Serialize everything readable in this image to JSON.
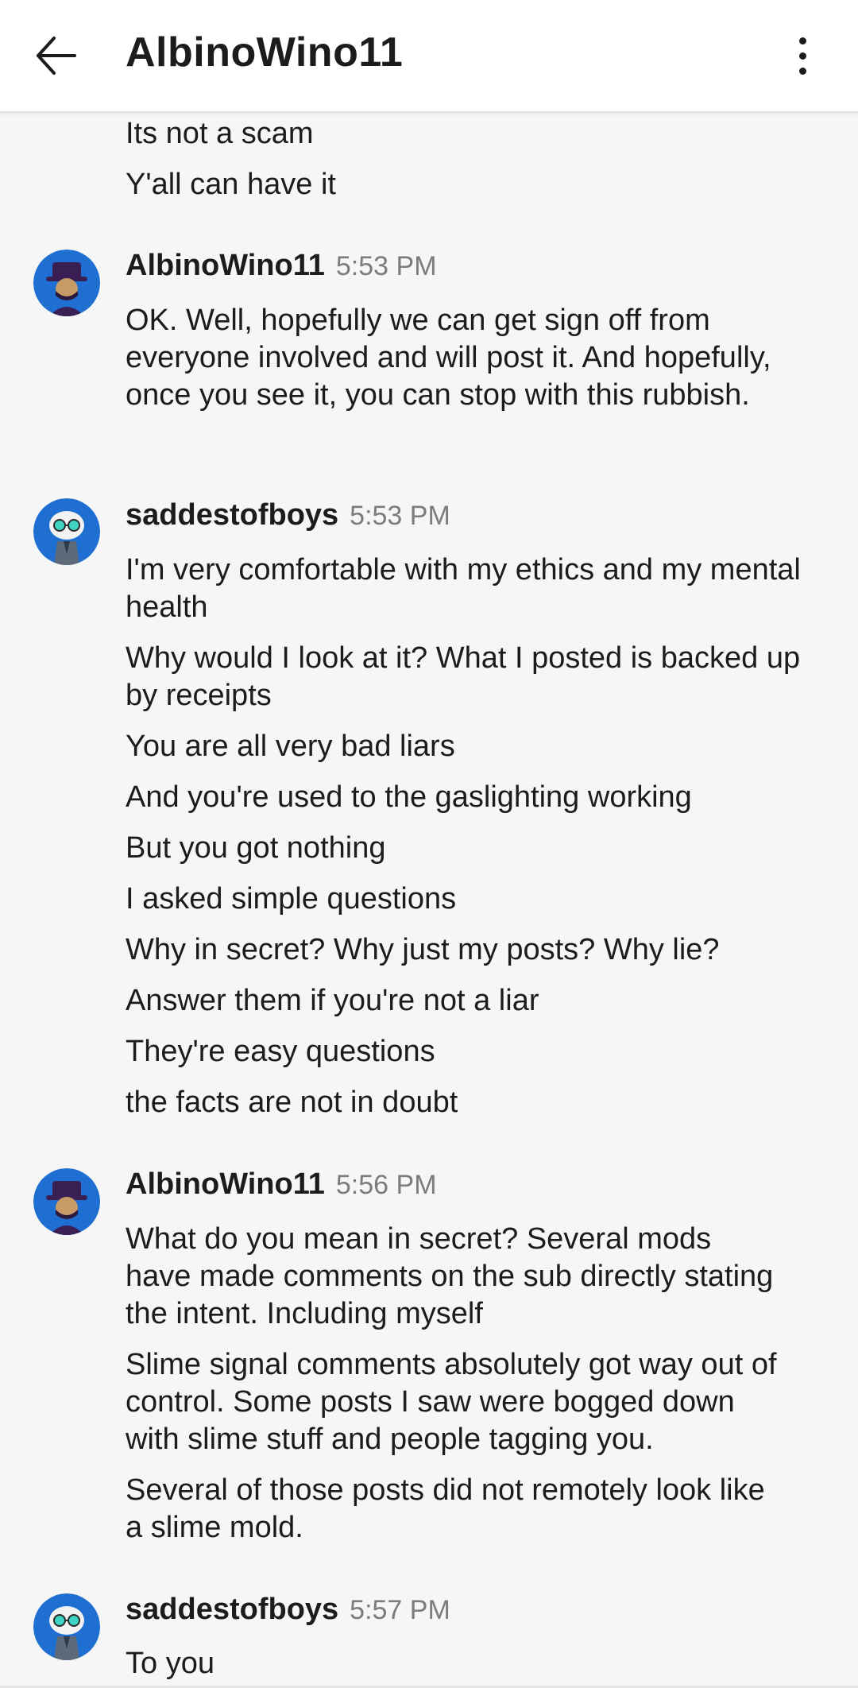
{
  "header": {
    "title": "AlbinoWino11",
    "back_icon": "arrow-left-icon",
    "menu_icon": "more-vertical-icon"
  },
  "colors": {
    "background": "#f6f6f6",
    "header_bg": "#ffffff",
    "timestamp": "#7c7c7c",
    "avatar_bg": "#1e6fd1"
  },
  "chat": {
    "preamble": [
      "Its not a scam",
      "Y'all can have it"
    ],
    "groups": [
      {
        "user": "AlbinoWino11",
        "time": "5:53 PM",
        "messages": [
          "OK.  Well, hopefully we can get sign off from everyone involved and will post it.  And hopefully, once you see it, you can stop with this rubbish."
        ]
      },
      {
        "user": "saddestofboys",
        "time": "5:53 PM",
        "messages": [
          "I'm very comfortable with my ethics and my mental health",
          "Why would I look at it? What I posted is backed up by receipts",
          "You are all very bad liars",
          "And you're used to the gaslighting working",
          "But you got nothing",
          "I asked simple questions",
          "Why in secret? Why just my posts? Why lie?",
          "Answer them if you're not a liar",
          "They're easy questions",
          "the facts are not in doubt"
        ]
      },
      {
        "user": "AlbinoWino11",
        "time": "5:56 PM",
        "messages": [
          "What do you mean in secret?  Several mods have made comments on the sub directly stating the intent.  Including myself",
          "Slime signal comments absolutely got way out of control.  Some posts I saw were bogged down with slime stuff and people tagging you.",
          "Several of those posts did not remotely look like a slime mold."
        ]
      },
      {
        "user": "saddestofboys",
        "time": "5:57 PM",
        "messages": [
          "To you"
        ]
      }
    ]
  }
}
